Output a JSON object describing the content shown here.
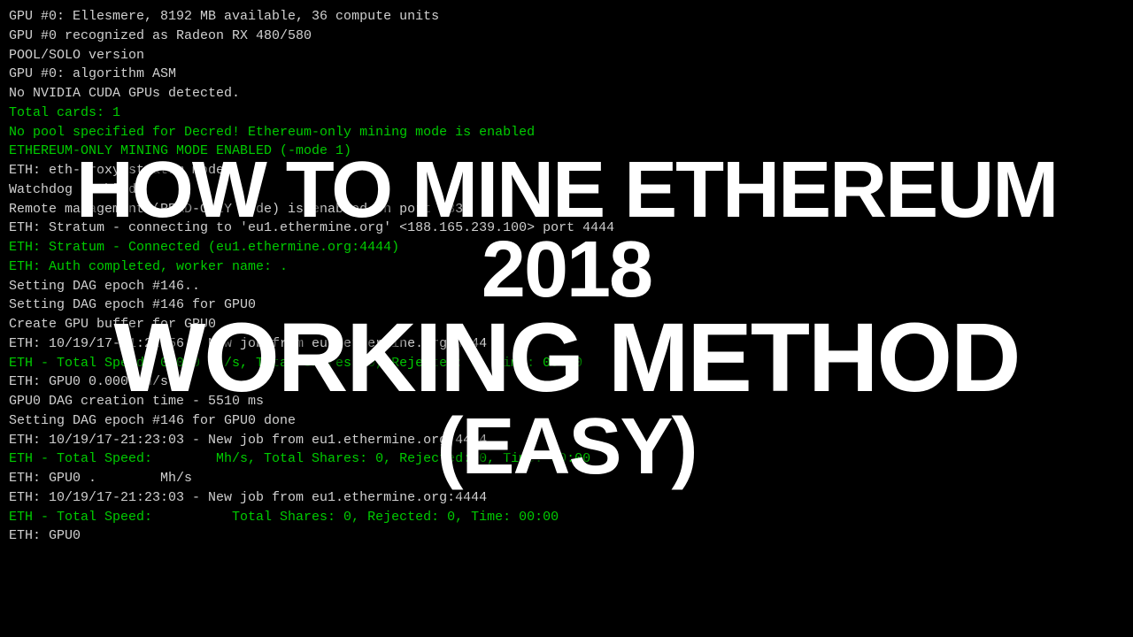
{
  "terminal": {
    "lines": [
      {
        "text": "GPU #0: Ellesmere, 8192 MB available, 36 compute units",
        "color": "white"
      },
      {
        "text": "GPU #0 recognized as Radeon RX 480/580",
        "color": "white"
      },
      {
        "text": "POOL/SOLO version",
        "color": "white"
      },
      {
        "text": "GPU #0: algorithm ASM",
        "color": "white"
      },
      {
        "text": "No NVIDIA CUDA GPUs detected.",
        "color": "white"
      },
      {
        "text": "Total cards: 1",
        "color": "green"
      },
      {
        "text": "No pool specified for Decred! Ethereum-only mining mode is enabled",
        "color": "green"
      },
      {
        "text": "ETHEREUM-ONLY MINING MODE ENABLED (-mode 1)",
        "color": "green"
      },
      {
        "text": "ETH: eth-proxy stratum mode",
        "color": "white"
      },
      {
        "text": "Watchdog enabled",
        "color": "white"
      },
      {
        "text": "Remote management (READ-ONLY Mode) is enabled on port 3333",
        "color": "white"
      },
      {
        "text": "",
        "color": "white"
      },
      {
        "text": "ETH: Stratum - connecting to 'eu1.ethermine.org' <188.165.239.100> port 4444",
        "color": "white"
      },
      {
        "text": "ETH: Stratum - Connected (eu1.ethermine.org:4444)",
        "color": "green"
      },
      {
        "text": "ETH: Auth completed, worker name: .",
        "color": "green"
      },
      {
        "text": "Setting DAG epoch #146..",
        "color": "white"
      },
      {
        "text": "Setting DAG epoch #146 for GPU0",
        "color": "white"
      },
      {
        "text": "Create GPU buffer for GPU0",
        "color": "white"
      },
      {
        "text": "ETH: 10/19/17-21:22:56 - New job from eu1.ethermine.org:4444",
        "color": "white"
      },
      {
        "text": "ETH - Total Speed: 0.000 Mh/s, Total Shares: 0, Rejected: 0, Time: 00:00",
        "color": "green"
      },
      {
        "text": "ETH: GPU0 0.000 Mh/s",
        "color": "white"
      },
      {
        "text": "GPU0 DAG creation time - 5510 ms",
        "color": "white"
      },
      {
        "text": "Setting DAG epoch #146 for GPU0 done",
        "color": "white"
      },
      {
        "text": "ETH: 10/19/17-21:23:03 - New job from eu1.ethermine.org:4444",
        "color": "white"
      },
      {
        "text": "ETH - Total Speed:        Mh/s, Total Shares: 0, Rejected: 0, Time: 00:00",
        "color": "green"
      },
      {
        "text": "ETH: GPU0 .        Mh/s",
        "color": "white"
      },
      {
        "text": "ETH: 10/19/17-21:23:03 - New job from eu1.ethermine.org:4444",
        "color": "white"
      },
      {
        "text": "ETH - Total Speed:          Total Shares: 0, Rejected: 0, Time: 00:00",
        "color": "green"
      },
      {
        "text": "ETH: GPU0",
        "color": "white"
      }
    ]
  },
  "overlay": {
    "line1": "HOW TO MINE ETHEREUM 2018",
    "line2": "WORKING METHOD",
    "line3": "(EASY)"
  }
}
